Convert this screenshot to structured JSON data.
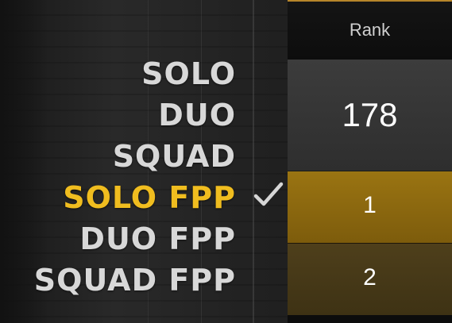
{
  "mode_menu": {
    "items": [
      {
        "label": "SOLO",
        "selected": false
      },
      {
        "label": "DUO",
        "selected": false
      },
      {
        "label": "SQUAD",
        "selected": false
      },
      {
        "label": "SOLO FPP",
        "selected": true
      },
      {
        "label": "DUO FPP",
        "selected": false
      },
      {
        "label": "SQUAD FPP",
        "selected": false
      }
    ],
    "selected_icon": "check-icon"
  },
  "rank_panel": {
    "header": "Rank",
    "rows": [
      "178",
      "1",
      "2"
    ]
  },
  "colors": {
    "selected_text": "#f0bd1f",
    "default_text": "#d8d8d8",
    "accent_border": "#b6852a",
    "highlight_row": "#8a6810",
    "dim_gold_row": "#463817"
  }
}
